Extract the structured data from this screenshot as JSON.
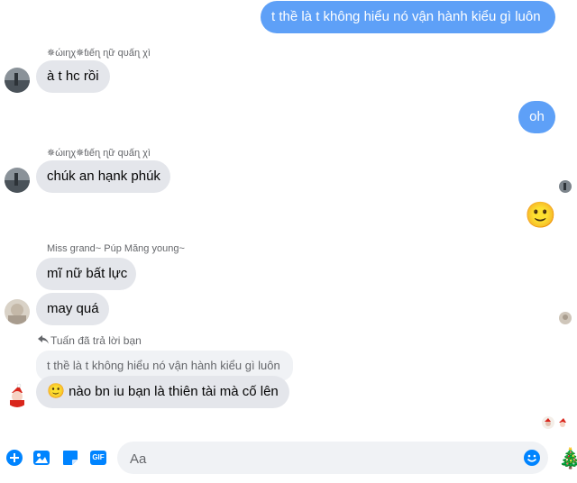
{
  "messages": {
    "m1": "t thề là t không hiểu nó vận hành kiểu gì luôn",
    "m2_sender": "✵ώιɳχ✵ƭιếɳ ɳữ qυấɳ χì",
    "m2": "à t hc rồi",
    "m3": "oh",
    "m4_sender": "✵ώιɳχ✵ƭιếɳ ɳữ qυấɳ χì",
    "m4": "chúk an hạnk phúk",
    "m5_emoji": "🙂",
    "m6_sender": "Miss grand~ Púp Măng young~",
    "m6": "mĩ nữ bất lực",
    "m7": "may quá",
    "reply_label": "Tuấn đã trả lời bạn",
    "reply_quote": "t thề là t không hiểu nó vận hành kiểu gì luôn",
    "m8_emoji": "🙂",
    "m8": "nào bn iu bạn là thiên tài mà cố lên"
  },
  "composer": {
    "placeholder": "Aa",
    "like_emoji": "🎄"
  },
  "icons": {
    "add": "plus-circle-icon",
    "photo": "photo-icon",
    "sticker": "sticker-icon",
    "gif": "gif-icon",
    "gif_text": "GIF",
    "emoji": "smiley-icon",
    "reply": "reply-arrow-icon"
  },
  "colors": {
    "accent": "#0084ff",
    "outgoing_bubble": "#5ea0f7",
    "incoming_bubble": "#e4e6eb"
  }
}
